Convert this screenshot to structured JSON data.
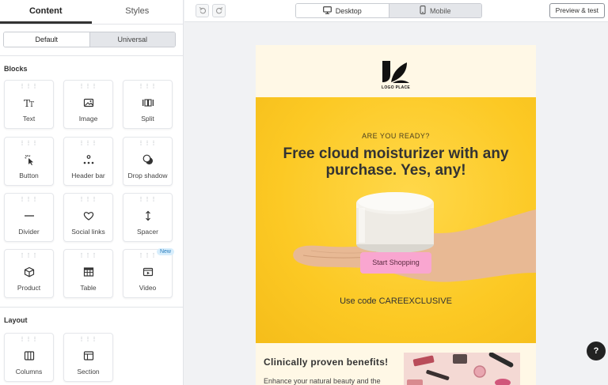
{
  "sidebar": {
    "tabs": [
      {
        "label": "Content"
      },
      {
        "label": "Styles"
      }
    ],
    "mode": {
      "default_label": "Default",
      "universal_label": "Universal"
    },
    "blocks_title": "Blocks",
    "blocks": [
      {
        "label": "Text",
        "icon": "text-icon"
      },
      {
        "label": "Image",
        "icon": "image-icon"
      },
      {
        "label": "Split",
        "icon": "split-icon"
      },
      {
        "label": "Button",
        "icon": "button-icon"
      },
      {
        "label": "Header bar",
        "icon": "header-bar-icon"
      },
      {
        "label": "Drop shadow",
        "icon": "drop-shadow-icon"
      },
      {
        "label": "Divider",
        "icon": "divider-icon"
      },
      {
        "label": "Social links",
        "icon": "heart-icon"
      },
      {
        "label": "Spacer",
        "icon": "spacer-icon"
      },
      {
        "label": "Product",
        "icon": "product-icon"
      },
      {
        "label": "Table",
        "icon": "table-icon"
      },
      {
        "label": "Video",
        "icon": "video-icon",
        "badge": "New"
      }
    ],
    "layout_title": "Layout",
    "layouts": [
      {
        "label": "Columns",
        "icon": "columns-icon"
      },
      {
        "label": "Section",
        "icon": "section-icon"
      }
    ]
  },
  "toolbar": {
    "undo_icon": "undo-icon",
    "redo_icon": "redo-icon",
    "desktop_label": "Desktop",
    "mobile_label": "Mobile",
    "preview_label": "Preview & test"
  },
  "email": {
    "logo_text": "LOGO PLACE",
    "eyebrow": "ARE YOU READY?",
    "headline": "Free cloud moisturizer with any purchase. Yes, any!",
    "cta_label": "Start Shopping",
    "code_text": "Use code CAREEXCLUSIVE",
    "benefits_title": "Clinically proven benefits!",
    "benefits_text": "Enhance your natural beauty and the"
  },
  "help_label": "?",
  "colors": {
    "hero_yellow": "#fcc924",
    "cta_pink": "#f9a6d0",
    "cream": "#fff8e6"
  }
}
